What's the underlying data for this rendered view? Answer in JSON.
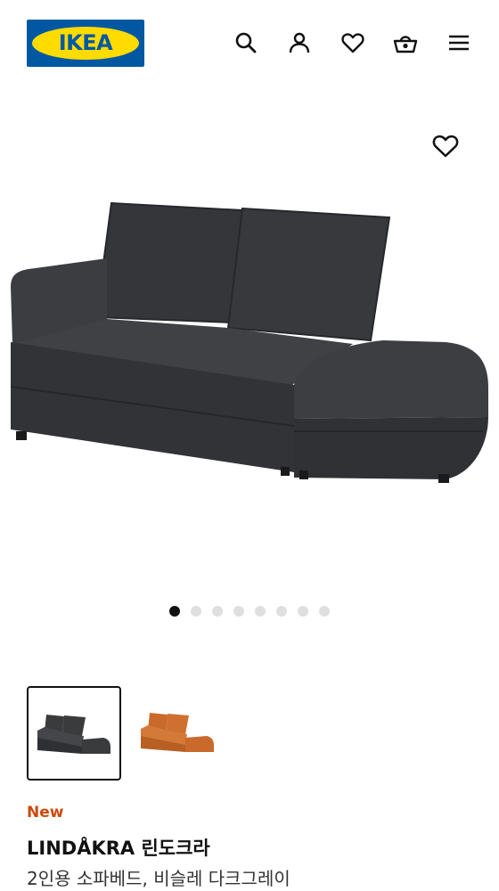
{
  "header": {
    "logo_text": "IKEA",
    "icons": [
      "search-icon",
      "user-icon",
      "heart-icon",
      "basket-icon",
      "menu-icon"
    ]
  },
  "gallery": {
    "image_count": 8,
    "active_index": 0
  },
  "variants": [
    {
      "name": "dark-grey",
      "color": "#3a3b3d",
      "selected": true
    },
    {
      "name": "orange",
      "color": "#c9692b",
      "selected": false
    }
  ],
  "product": {
    "badge": "New",
    "name": "LINDÅKRA 린도크라",
    "description": "2인용 소파베드, 비슬레 다크그레이"
  },
  "colors": {
    "ikea_blue": "#0058a3",
    "ikea_yellow": "#ffdb00",
    "new_badge": "#cc4a0a"
  }
}
